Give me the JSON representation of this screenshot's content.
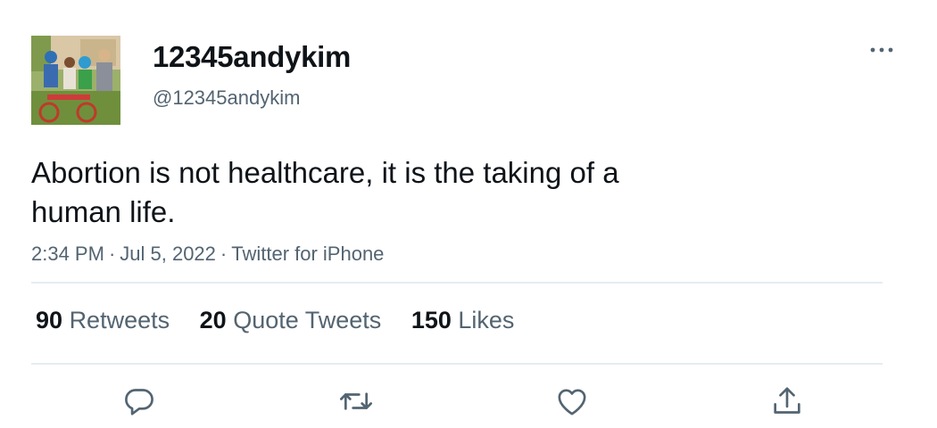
{
  "user": {
    "display_name": "12345andykim",
    "handle": "@12345andykim",
    "avatar_description": "family-photo-avatar"
  },
  "menu": {
    "icon": "more-horizontal-icon"
  },
  "tweet": {
    "text": "Abortion is not healthcare, it is the taking of a human life."
  },
  "meta": {
    "time": "2:34 PM",
    "separator": "·",
    "date": "Jul 5, 2022",
    "source": "Twitter for iPhone"
  },
  "stats": {
    "retweets": {
      "count": "90",
      "label": "Retweets"
    },
    "quote_tweets": {
      "count": "20",
      "label": "Quote Tweets"
    },
    "likes": {
      "count": "150",
      "label": "Likes"
    }
  },
  "actions": [
    {
      "name": "reply",
      "icon": "reply-icon"
    },
    {
      "name": "retweet",
      "icon": "retweet-icon"
    },
    {
      "name": "like",
      "icon": "heart-icon"
    },
    {
      "name": "share",
      "icon": "share-icon"
    }
  ],
  "colors": {
    "text_primary": "#0f1419",
    "text_secondary": "#536471",
    "divider": "#e6ecf0"
  }
}
